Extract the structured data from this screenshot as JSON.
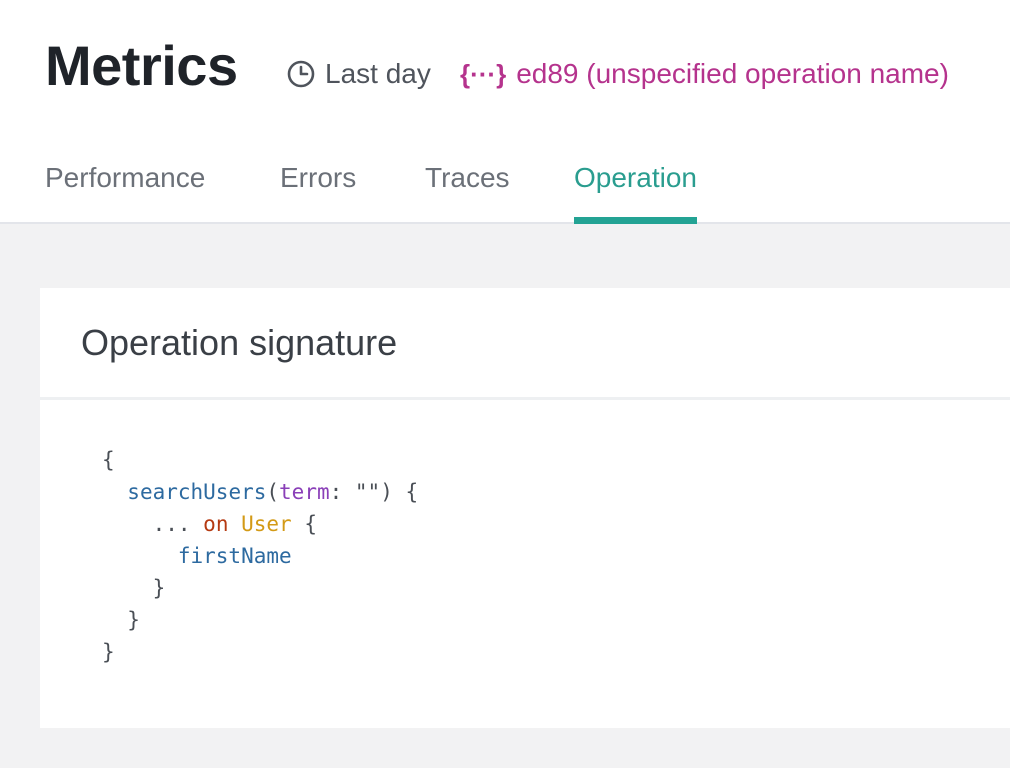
{
  "header": {
    "title": "Metrics",
    "time_range": "Last day",
    "operation": {
      "icon": "{···}",
      "label": "ed89 (unspecified operation name)"
    }
  },
  "tabs": [
    {
      "label": "Performance",
      "active": false
    },
    {
      "label": "Errors",
      "active": false
    },
    {
      "label": "Traces",
      "active": false
    },
    {
      "label": "Operation",
      "active": true
    }
  ],
  "signature_card": {
    "title": "Operation signature",
    "code": {
      "open_brace": "{",
      "field_name": "searchUsers",
      "paren_open": "(",
      "arg_name": "term",
      "arg_sep": ": ",
      "arg_value": "\"\"",
      "paren_close_brace": ") {",
      "spread": "...",
      "on_keyword": "on",
      "type_name": "User",
      "type_brace": "{",
      "sub_field": "firstName",
      "close_brace": "}"
    }
  },
  "colors": {
    "accent": "#23a394",
    "operation": "#b5338d"
  }
}
